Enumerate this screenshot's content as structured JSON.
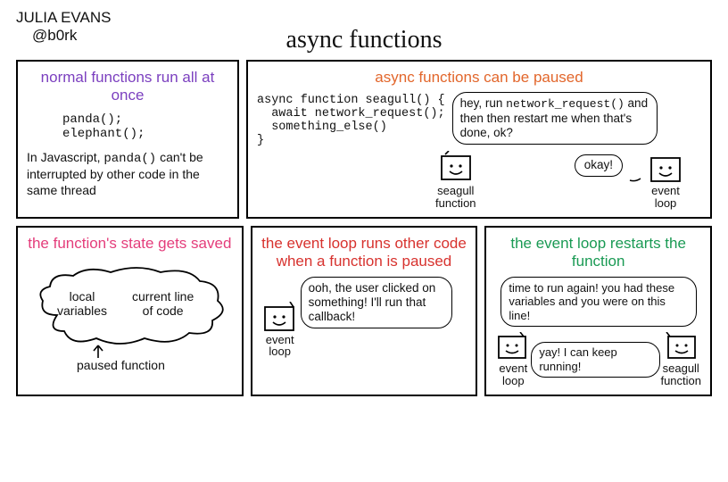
{
  "author": {
    "name": "JULIA EVANS",
    "handle": "@b0rk"
  },
  "title": "async functions",
  "panel1": {
    "title": "normal functions run all at once",
    "code": "panda();\nelephant();",
    "note_pre": "In Javascript, ",
    "note_code": "panda()",
    "note_post": " can't be interrupted by other code in the same thread"
  },
  "panel2": {
    "title": "async functions can be paused",
    "code": "async function seagull() {\n  await network_request();\n  something_else()\n}",
    "bubble1_pre": "hey, run ",
    "bubble1_code": "network_request()",
    "bubble1_post": " and then then restart me when that's done, ok?",
    "bubble2": "okay!",
    "char1": "seagull function",
    "char2": "event loop"
  },
  "panel3": {
    "title": "the function's state gets saved",
    "cloud_left": "local variables",
    "cloud_right": "current line of code",
    "caption": "paused function"
  },
  "panel4": {
    "title": "the event loop runs other code when a function is paused",
    "bubble": "ooh, the user clicked on something! I'll run that callback!",
    "char": "event loop"
  },
  "panel5": {
    "title": "the event loop restarts the function",
    "bubble1": "time to run again! you had these variables and you were on this line!",
    "bubble2": "yay! I can keep running!",
    "char1": "event loop",
    "char2": "seagull function"
  }
}
